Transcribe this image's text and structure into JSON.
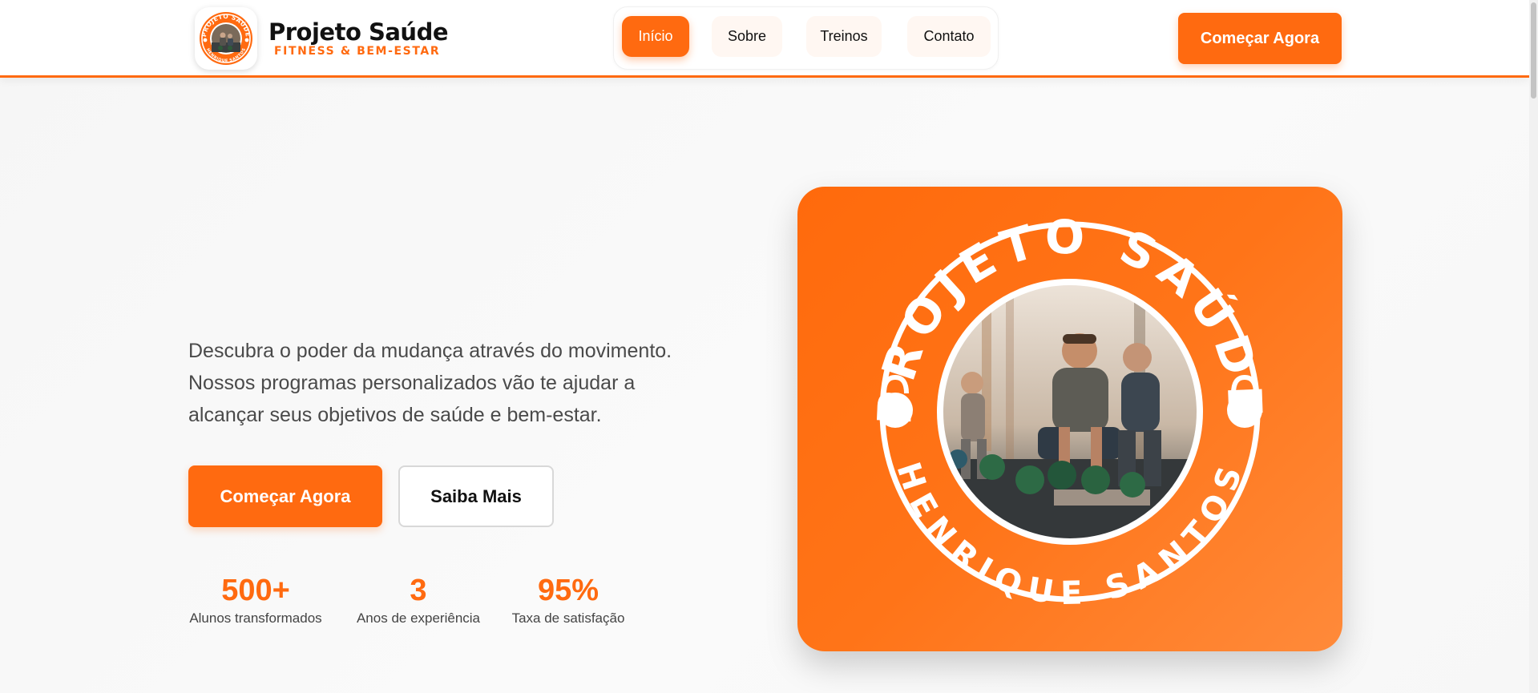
{
  "header": {
    "brand_title": "Projeto Saúde",
    "brand_subtitle": "FITNESS & BEM-ESTAR",
    "nav": [
      {
        "label": "Início",
        "active": true
      },
      {
        "label": "Sobre",
        "active": false
      },
      {
        "label": "Treinos",
        "active": false
      },
      {
        "label": "Contato",
        "active": false
      }
    ],
    "cta_label": "Começar Agora"
  },
  "hero": {
    "description": "Descubra o poder da mudança através do movimento. Nossos programas personalizados vão te ajudar a alcançar seus objetivos de saúde e bem-estar.",
    "primary_button": "Começar Agora",
    "secondary_button": "Saiba Mais",
    "stats": [
      {
        "value": "500+",
        "label": "Alunos transformados"
      },
      {
        "value": "3",
        "label": "Anos de experiência"
      },
      {
        "value": "95%",
        "label": "Taxa de satisfação"
      }
    ],
    "logo_badge": {
      "top_text": "PROJETO SAÚDE",
      "bottom_text": "HENRIQUE SANTOS"
    }
  },
  "colors": {
    "accent": "#ff6a10",
    "text_dark": "#111111",
    "text_body": "#4a4a4a"
  }
}
